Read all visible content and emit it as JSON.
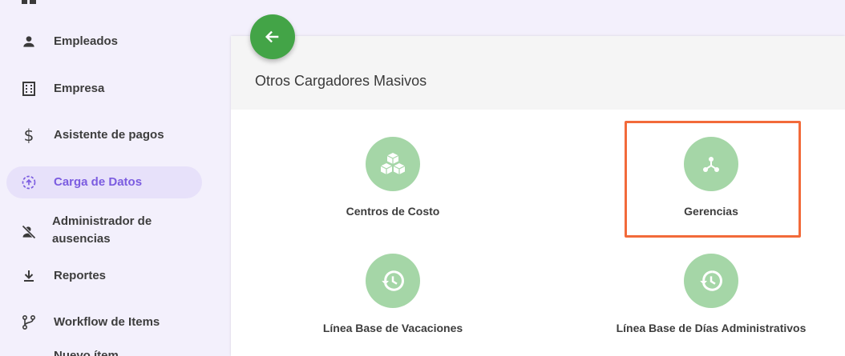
{
  "sidebar": {
    "items": [
      {
        "label": "Empleados",
        "icon": "person-icon"
      },
      {
        "label": "Empresa",
        "icon": "building-icon"
      },
      {
        "label": "Asistente de pagos",
        "icon": "dollar-icon"
      },
      {
        "label": "Carga de Datos",
        "icon": "upload-circle-icon",
        "active": true
      },
      {
        "label": "Administrador de ausencias",
        "icon": "person-off-icon"
      },
      {
        "label": "Reportes",
        "icon": "download-icon"
      },
      {
        "label": "Workflow de Items",
        "icon": "fork-icon"
      }
    ],
    "bottom_partial": "Nuevo ítem"
  },
  "main": {
    "title": "Otros Cargadores Masivos",
    "tiles": [
      {
        "label": "Centros de Costo",
        "icon": "cubes-icon"
      },
      {
        "label": "Gerencias",
        "icon": "hierarchy-icon",
        "highlighted": true
      },
      {
        "label": "Línea Base de Vacaciones",
        "icon": "history-icon"
      },
      {
        "label": "Línea Base de Días Administrativos",
        "icon": "history-icon"
      }
    ]
  },
  "colors": {
    "accent": "#7b5ce0",
    "active_bg": "#e7e1fa",
    "back_button": "#43a447",
    "tile_circle": "#a5d6a7",
    "highlight_border": "#f26a3a",
    "page_bg": "#f3f0fc"
  }
}
